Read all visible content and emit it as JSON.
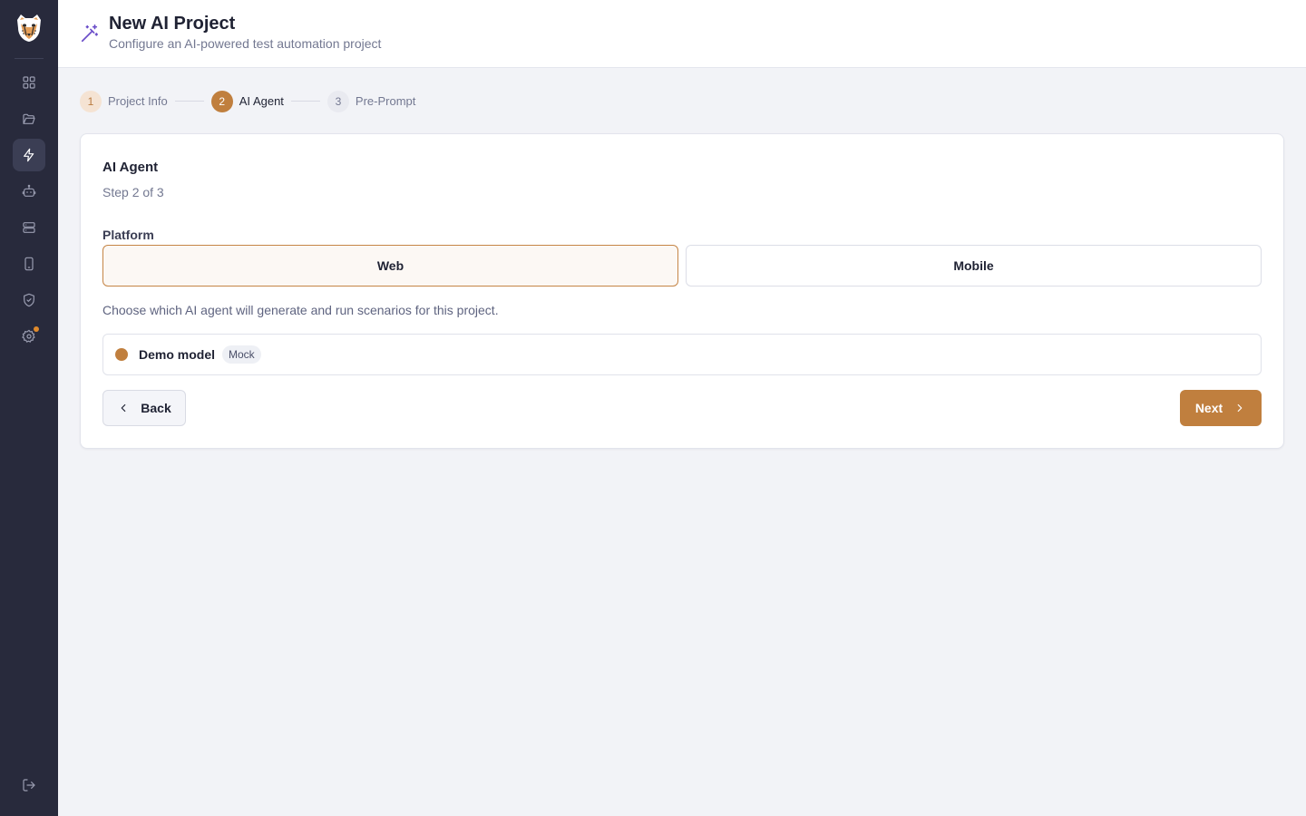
{
  "header": {
    "title": "New AI Project",
    "subtitle": "Configure an AI-powered test automation project",
    "icon": "magic-wand-icon"
  },
  "sidebar": {
    "logo": "cheetah-logo",
    "items": [
      {
        "icon": "dashboard-icon",
        "active": false
      },
      {
        "icon": "folder-icon",
        "active": false
      },
      {
        "icon": "lightning-icon",
        "active": true
      },
      {
        "icon": "robot-icon",
        "active": false
      },
      {
        "icon": "server-icon",
        "active": false
      },
      {
        "icon": "smartphone-icon",
        "active": false
      },
      {
        "icon": "shield-check-icon",
        "active": false
      },
      {
        "icon": "settings-icon",
        "active": false,
        "notification": true
      }
    ],
    "bottom_icon": "logout-icon"
  },
  "stepper": {
    "steps": [
      {
        "number": "1",
        "label": "Project Info",
        "state": "done"
      },
      {
        "number": "2",
        "label": "AI Agent",
        "state": "current"
      },
      {
        "number": "3",
        "label": "Pre-Prompt",
        "state": "todo"
      }
    ]
  },
  "card": {
    "title": "AI Agent",
    "step_text": "Step 2 of 3",
    "platform_label": "Platform",
    "platforms": {
      "web": "Web",
      "mobile": "Mobile"
    },
    "selected_platform": "Web",
    "helper_text": "Choose which AI agent will generate and run scenarios for this project.",
    "agent": {
      "name": "Demo model",
      "badge": "Mock"
    },
    "back_label": "Back",
    "next_label": "Next"
  },
  "colors": {
    "accent": "#c07f3e",
    "sidebar_bg": "#282a3c",
    "page_bg": "#f2f3f7",
    "header_icon": "#6b4ec9"
  }
}
